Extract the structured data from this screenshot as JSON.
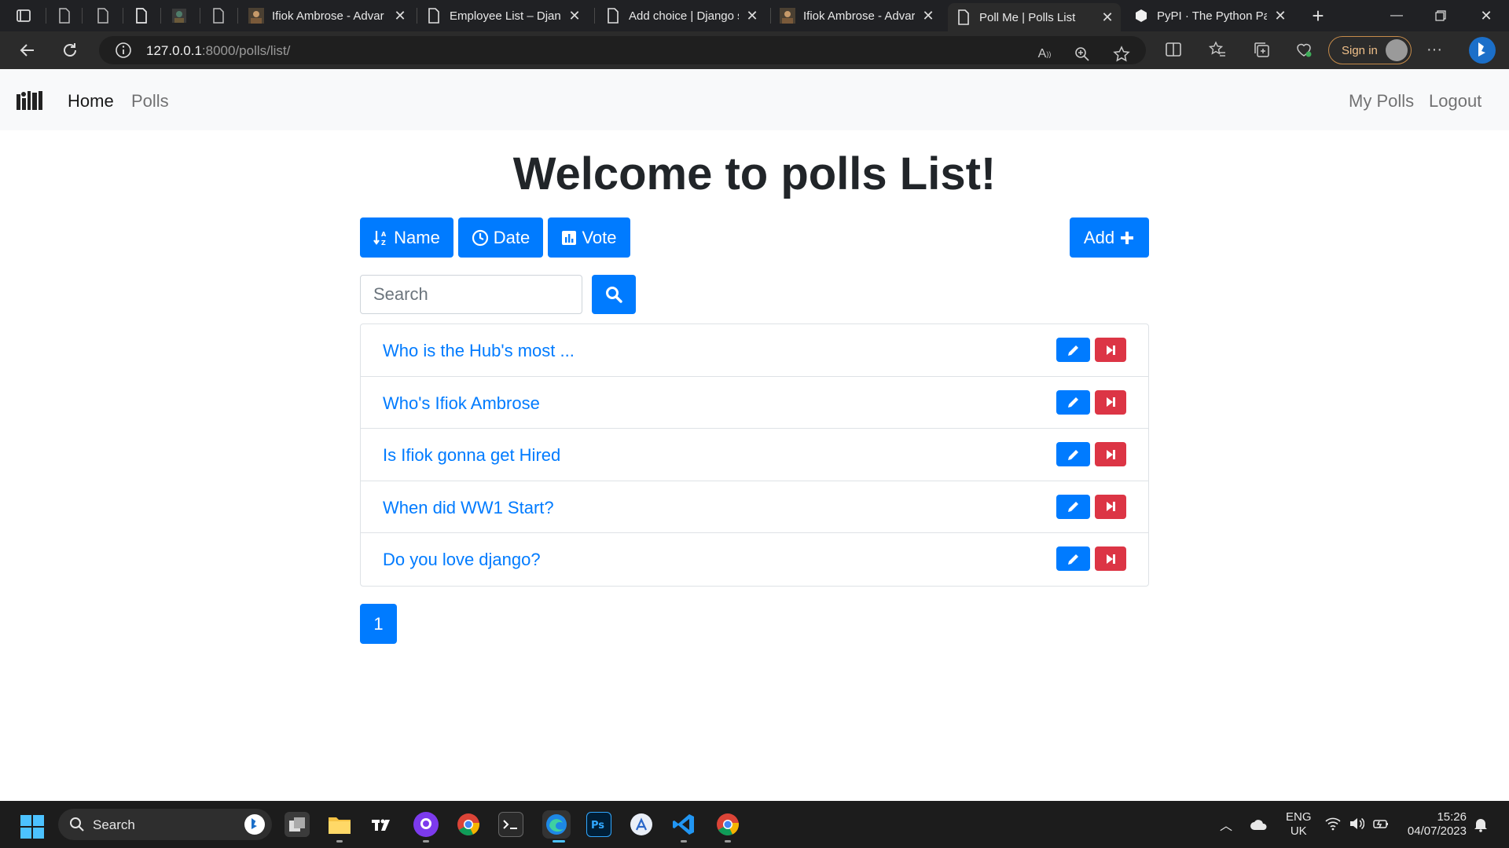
{
  "browser": {
    "tabs": [
      {
        "label": "Ifiok Ambrose - Advar",
        "favicon": "avatar-image"
      },
      {
        "label": "Employee List – Djang",
        "favicon": "page-icon"
      },
      {
        "label": "Add choice | Django s",
        "favicon": "page-icon"
      },
      {
        "label": "Ifiok Ambrose - Advar",
        "favicon": "avatar-image"
      },
      {
        "label": "Poll Me | Polls List",
        "favicon": "page-icon",
        "active": true
      },
      {
        "label": "PyPI · The Python Pac",
        "favicon": "pypi-icon"
      }
    ],
    "url_host": "127.0.0.1",
    "url_path": ":8000/polls/list/",
    "signin_label": "Sign in"
  },
  "navbar": {
    "home": "Home",
    "polls": "Polls",
    "my_polls": "My Polls",
    "logout": "Logout"
  },
  "main": {
    "title": "Welcome to polls List!",
    "sort_buttons": {
      "name": "Name",
      "date": "Date",
      "vote": "Vote"
    },
    "add_label": "Add",
    "search_placeholder": "Search",
    "polls": [
      "Who is the Hub's most ...",
      "Who's Ifiok Ambrose",
      "Is Ifiok gonna get Hired",
      "When did WW1 Start?",
      "Do you love django?"
    ],
    "pagination": [
      "1"
    ]
  },
  "taskbar": {
    "search_label": "Search",
    "language": "ENG",
    "region": "UK",
    "time": "15:26",
    "date": "04/07/2023"
  },
  "colors": {
    "primary": "#007bff",
    "danger": "#dc3545",
    "navbar_bg": "#f8f9fa"
  }
}
